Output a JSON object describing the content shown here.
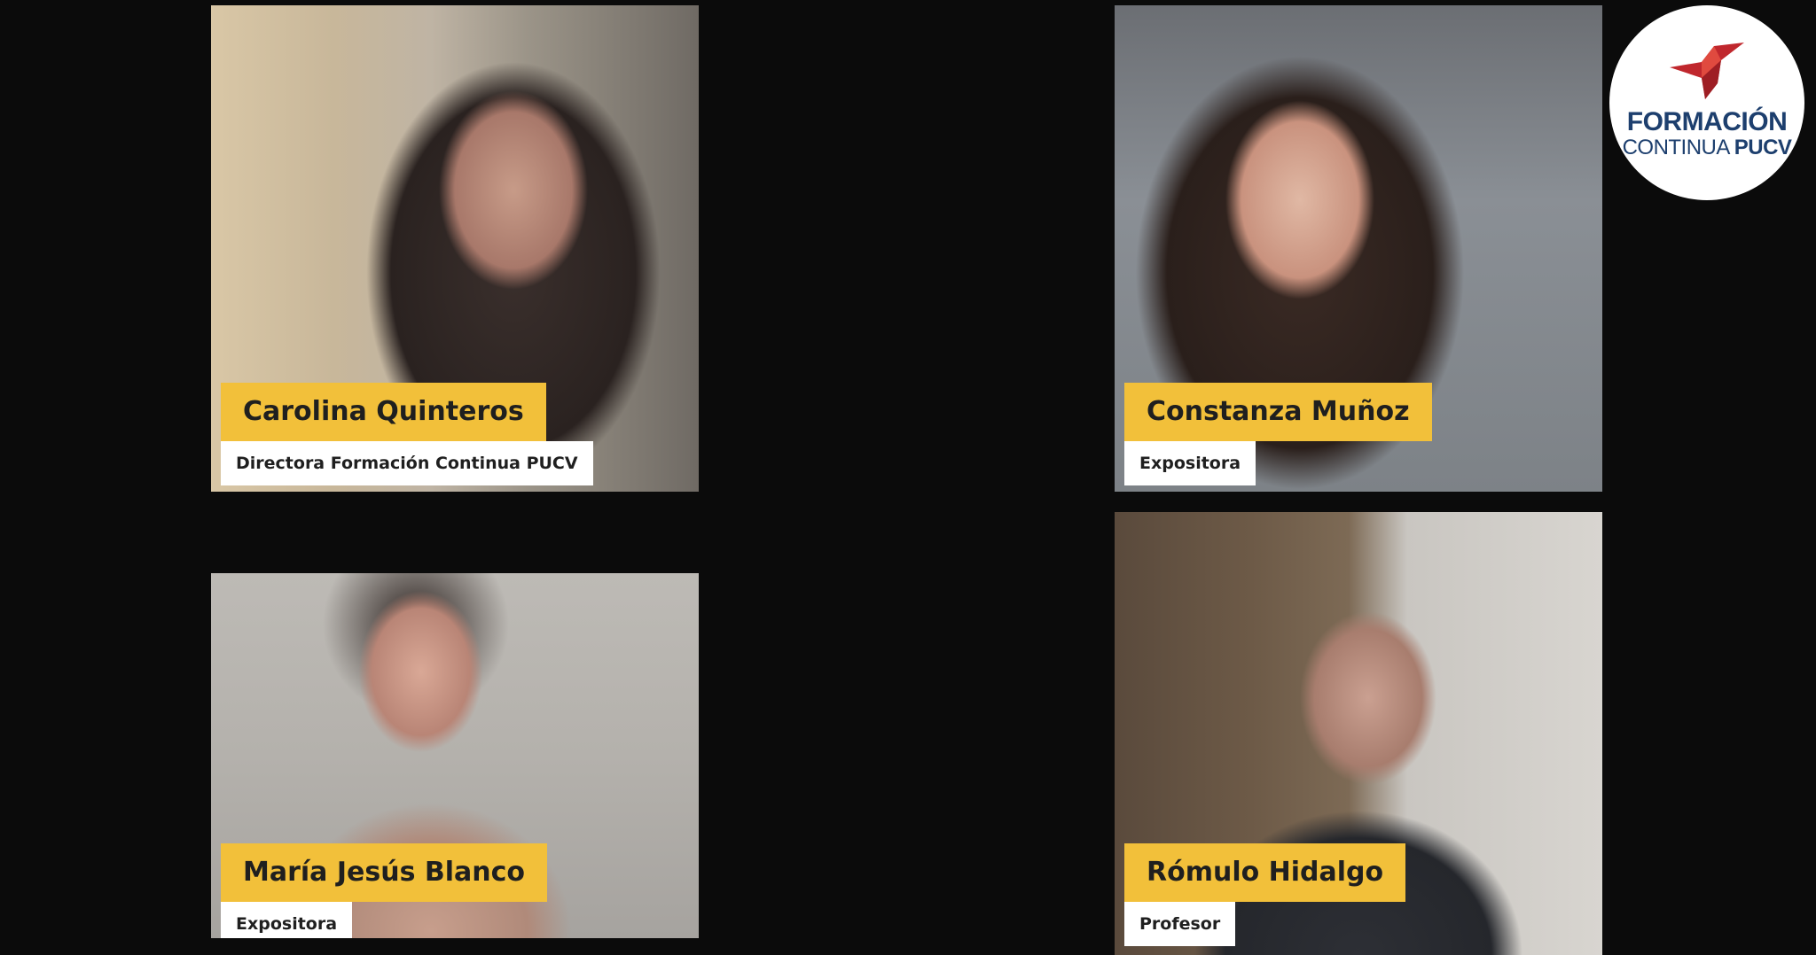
{
  "participants": [
    {
      "name": "Carolina Quinteros",
      "role": "Directora Formación Continua PUCV"
    },
    {
      "name": "Constanza Muñoz",
      "role": "Expositora"
    },
    {
      "name": "María Jesús Blanco",
      "role": "Expositora"
    },
    {
      "name": "Rómulo Hidalgo",
      "role": "Profesor"
    }
  ],
  "logo": {
    "line1": "FORMACIÓN",
    "line2_prefix": "CONTINUA ",
    "line2_bold": "PUCV",
    "icon": "paper-bird-icon",
    "brand_color": "#1d3f6e",
    "icon_color": "#c0272d"
  },
  "colors": {
    "name_tag": "#f2c03a",
    "role_tag": "#ffffff",
    "background": "#0b0b0b"
  }
}
